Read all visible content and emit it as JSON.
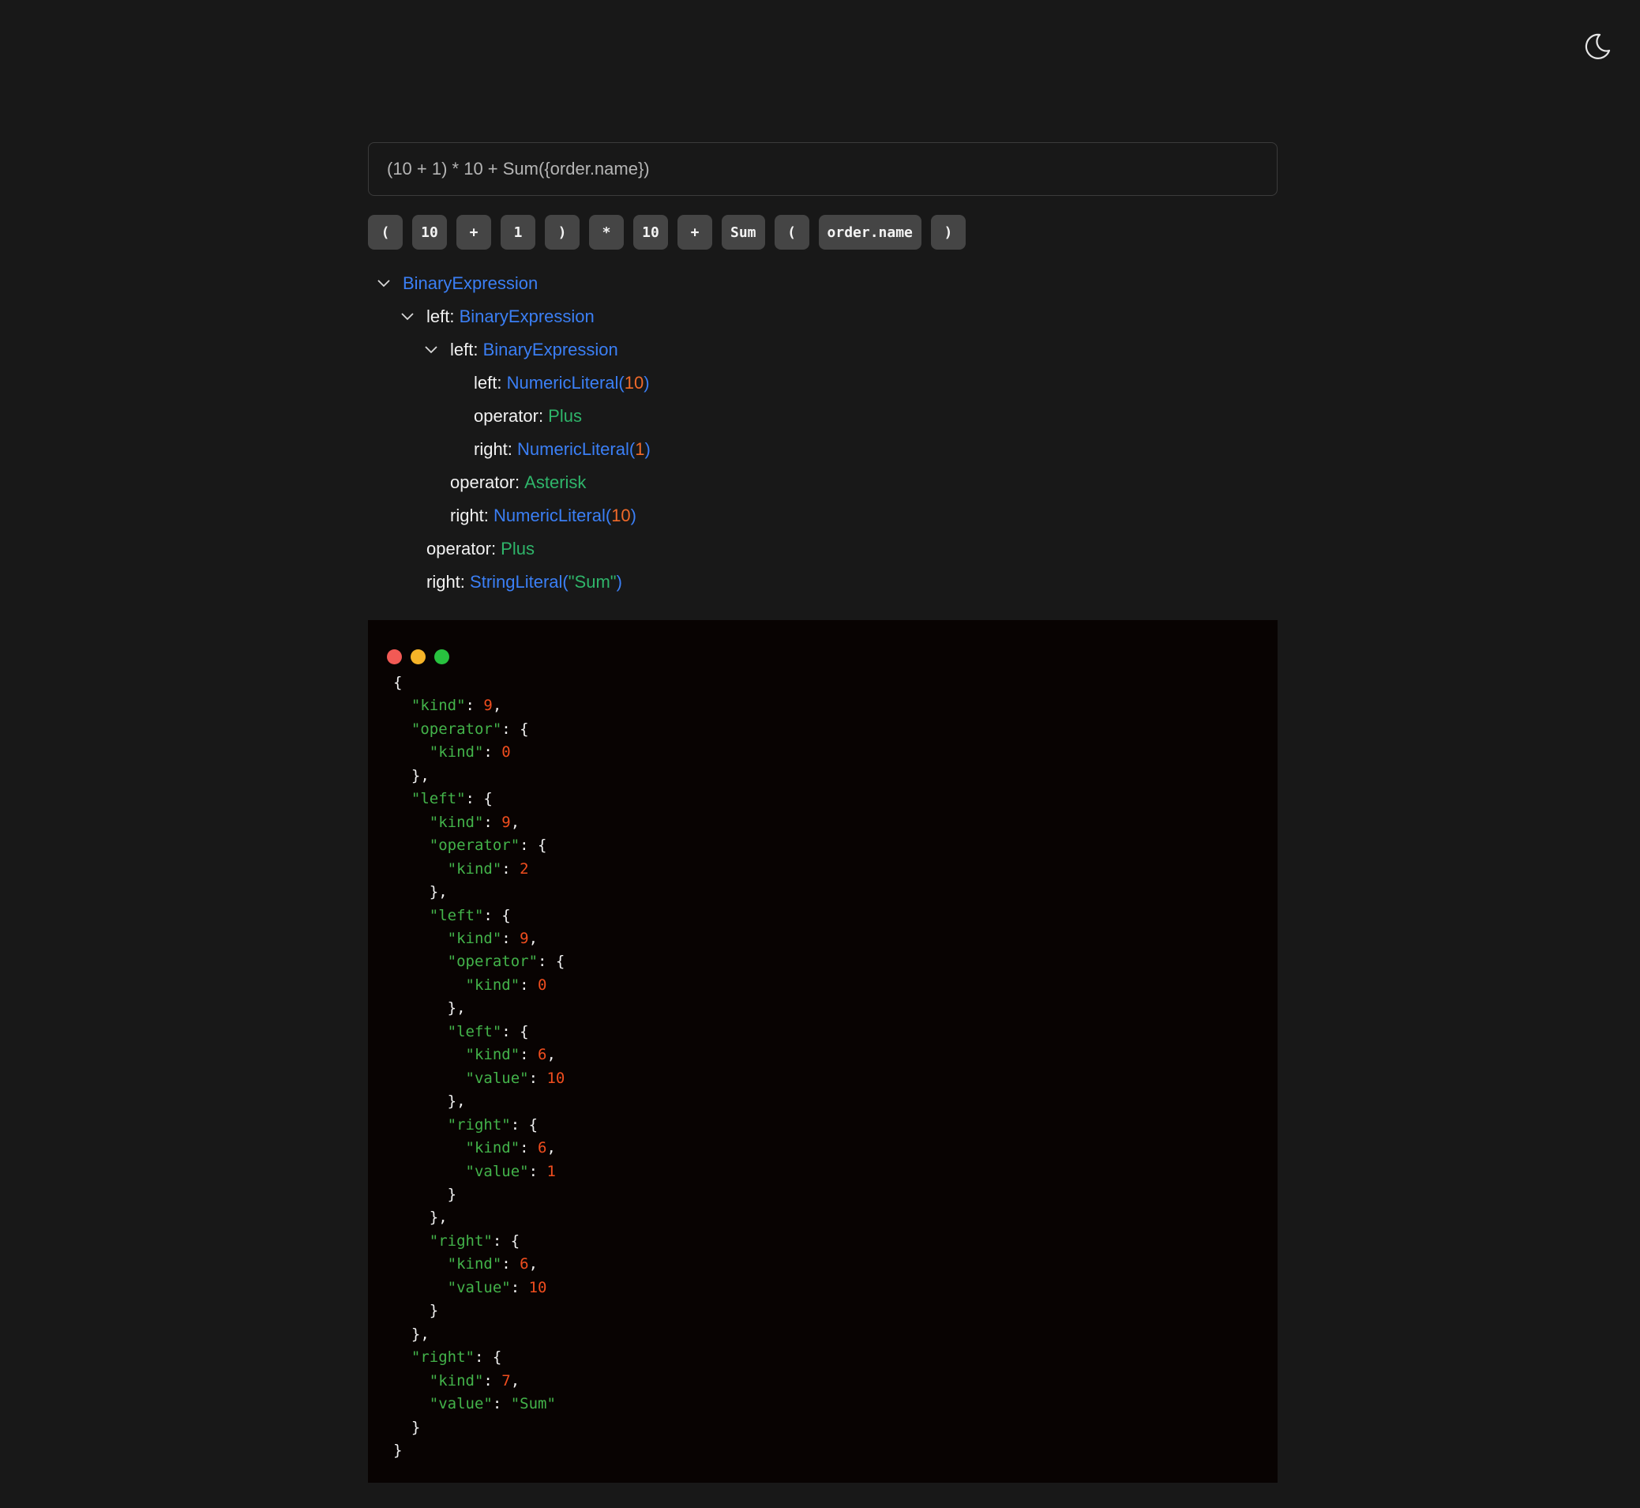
{
  "theme_toggle": {
    "icon": "moon-icon"
  },
  "expression_input": {
    "value": "(10 + 1) * 10 + Sum({order.name})"
  },
  "tokens": [
    "(",
    "10",
    "+",
    "1",
    ")",
    "*",
    "10",
    "+",
    "Sum",
    "(",
    "order.name",
    ")"
  ],
  "tree": [
    {
      "depth": 0,
      "expandable": true,
      "key": "",
      "type": "BinaryExpression",
      "value": "",
      "value_kind": ""
    },
    {
      "depth": 1,
      "expandable": true,
      "key": "left:",
      "type": "BinaryExpression",
      "value": "",
      "value_kind": ""
    },
    {
      "depth": 2,
      "expandable": true,
      "key": "left:",
      "type": "BinaryExpression",
      "value": "",
      "value_kind": ""
    },
    {
      "depth": 3,
      "expandable": false,
      "key": "left:",
      "type": "NumericLiteral(",
      "value": "10",
      "value_kind": "num",
      "close": ")"
    },
    {
      "depth": 3,
      "expandable": false,
      "key": "operator:",
      "type": "",
      "value": "Plus",
      "value_kind": "op"
    },
    {
      "depth": 3,
      "expandable": false,
      "key": "right:",
      "type": "NumericLiteral(",
      "value": "1",
      "value_kind": "num",
      "close": ")"
    },
    {
      "depth": 2,
      "expandable": false,
      "key": "operator:",
      "type": "",
      "value": "Asterisk",
      "value_kind": "op"
    },
    {
      "depth": 2,
      "expandable": false,
      "key": "right:",
      "type": "NumericLiteral(",
      "value": "10",
      "value_kind": "num",
      "close": ")"
    },
    {
      "depth": 1,
      "expandable": false,
      "key": "operator:",
      "type": "",
      "value": "Plus",
      "value_kind": "op"
    },
    {
      "depth": 1,
      "expandable": false,
      "key": "right:",
      "type": "StringLiteral(",
      "value": "\"Sum\"",
      "value_kind": "str",
      "close": ")"
    }
  ],
  "json_panel": {
    "window_controls": [
      "close",
      "minimize",
      "maximize"
    ],
    "lines": [
      {
        "indent": 0,
        "key": "",
        "value": "",
        "kind": "",
        "punc": "{"
      },
      {
        "indent": 1,
        "key": "\"kind\"",
        "value": "9",
        "kind": "num",
        "punc": ","
      },
      {
        "indent": 1,
        "key": "\"operator\"",
        "value": "",
        "kind": "",
        "punc": "{"
      },
      {
        "indent": 2,
        "key": "\"kind\"",
        "value": "0",
        "kind": "num",
        "punc": ""
      },
      {
        "indent": 1,
        "key": "",
        "value": "",
        "kind": "",
        "punc": "},"
      },
      {
        "indent": 1,
        "key": "\"left\"",
        "value": "",
        "kind": "",
        "punc": "{"
      },
      {
        "indent": 2,
        "key": "\"kind\"",
        "value": "9",
        "kind": "num",
        "punc": ","
      },
      {
        "indent": 2,
        "key": "\"operator\"",
        "value": "",
        "kind": "",
        "punc": "{"
      },
      {
        "indent": 3,
        "key": "\"kind\"",
        "value": "2",
        "kind": "num",
        "punc": ""
      },
      {
        "indent": 2,
        "key": "",
        "value": "",
        "kind": "",
        "punc": "},"
      },
      {
        "indent": 2,
        "key": "\"left\"",
        "value": "",
        "kind": "",
        "punc": "{"
      },
      {
        "indent": 3,
        "key": "\"kind\"",
        "value": "9",
        "kind": "num",
        "punc": ","
      },
      {
        "indent": 3,
        "key": "\"operator\"",
        "value": "",
        "kind": "",
        "punc": "{"
      },
      {
        "indent": 4,
        "key": "\"kind\"",
        "value": "0",
        "kind": "num",
        "punc": ""
      },
      {
        "indent": 3,
        "key": "",
        "value": "",
        "kind": "",
        "punc": "},"
      },
      {
        "indent": 3,
        "key": "\"left\"",
        "value": "",
        "kind": "",
        "punc": "{"
      },
      {
        "indent": 4,
        "key": "\"kind\"",
        "value": "6",
        "kind": "num",
        "punc": ","
      },
      {
        "indent": 4,
        "key": "\"value\"",
        "value": "10",
        "kind": "num",
        "punc": ""
      },
      {
        "indent": 3,
        "key": "",
        "value": "",
        "kind": "",
        "punc": "},"
      },
      {
        "indent": 3,
        "key": "\"right\"",
        "value": "",
        "kind": "",
        "punc": "{"
      },
      {
        "indent": 4,
        "key": "\"kind\"",
        "value": "6",
        "kind": "num",
        "punc": ","
      },
      {
        "indent": 4,
        "key": "\"value\"",
        "value": "1",
        "kind": "num",
        "punc": ""
      },
      {
        "indent": 3,
        "key": "",
        "value": "",
        "kind": "",
        "punc": "}"
      },
      {
        "indent": 2,
        "key": "",
        "value": "",
        "kind": "",
        "punc": "},"
      },
      {
        "indent": 2,
        "key": "\"right\"",
        "value": "",
        "kind": "",
        "punc": "{"
      },
      {
        "indent": 3,
        "key": "\"kind\"",
        "value": "6",
        "kind": "num",
        "punc": ","
      },
      {
        "indent": 3,
        "key": "\"value\"",
        "value": "10",
        "kind": "num",
        "punc": ""
      },
      {
        "indent": 2,
        "key": "",
        "value": "",
        "kind": "",
        "punc": "}"
      },
      {
        "indent": 1,
        "key": "",
        "value": "",
        "kind": "",
        "punc": "},"
      },
      {
        "indent": 1,
        "key": "\"right\"",
        "value": "",
        "kind": "",
        "punc": "{"
      },
      {
        "indent": 2,
        "key": "\"kind\"",
        "value": "7",
        "kind": "num",
        "punc": ","
      },
      {
        "indent": 2,
        "key": "\"value\"",
        "value": "\"Sum\"",
        "kind": "str",
        "punc": ""
      },
      {
        "indent": 1,
        "key": "",
        "value": "",
        "kind": "",
        "punc": "}"
      },
      {
        "indent": 0,
        "key": "",
        "value": "",
        "kind": "",
        "punc": "}"
      }
    ]
  }
}
